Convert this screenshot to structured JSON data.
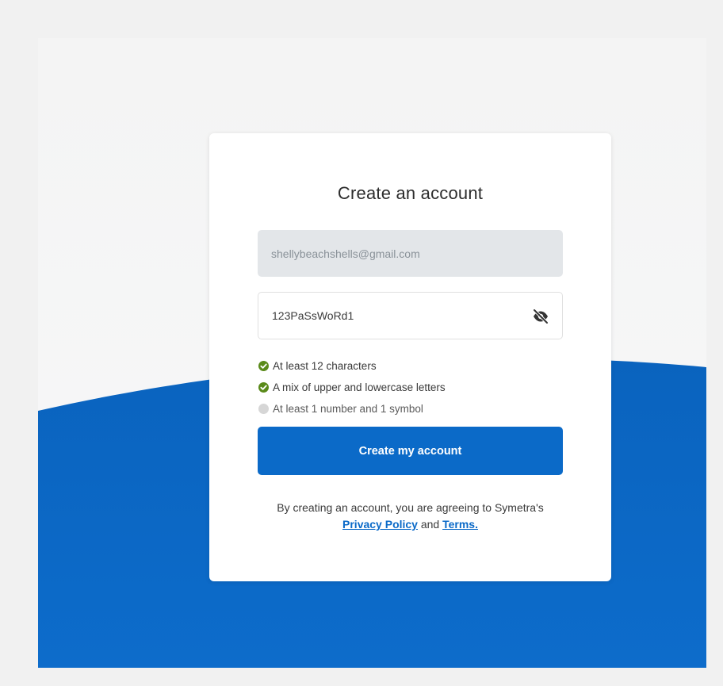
{
  "page": {
    "title": "Create an account",
    "email_value": "shellybeachshells@gmail.com",
    "password_value": "123PaSsWoRd1",
    "password_visibility_icon": "eye-slash-icon",
    "rules": [
      {
        "label": "At least 12 characters",
        "status": "met"
      },
      {
        "label": "A mix of upper and lowercase letters",
        "status": "met"
      },
      {
        "label": "At least 1 number and 1 symbol",
        "status": "unmet"
      }
    ],
    "submit_label": "Create my account",
    "legal": {
      "prefix": "By creating an account, you are agreeing to Symetra's",
      "privacy_label": "Privacy Policy",
      "conjunction": "and",
      "terms_label": "Terms."
    }
  },
  "colors": {
    "brand_blue": "#0b6ac8",
    "check_green": "#5a8a1a",
    "check_off": "#d6d6d6",
    "background": "#f1f1f1"
  }
}
